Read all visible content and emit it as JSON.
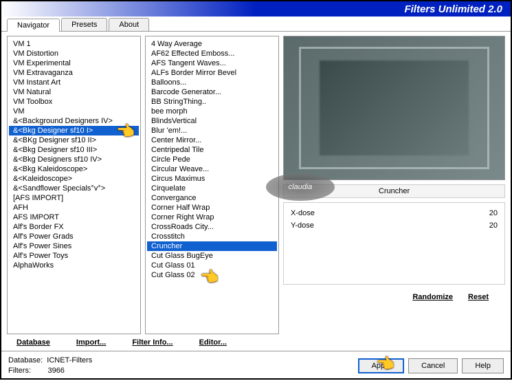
{
  "title": "Filters Unlimited 2.0",
  "tabs": [
    "Navigator",
    "Presets",
    "About"
  ],
  "list1": [
    "VM 1",
    "VM Distortion",
    "VM Experimental",
    "VM Extravaganza",
    "VM Instant Art",
    "VM Natural",
    "VM Toolbox",
    "VM",
    "&<Background Designers IV>",
    "&<Bkg Designer sf10 I>",
    "&<BKg Designer sf10 II>",
    "&<Bkg Designer sf10 III>",
    "&<Bkg Designers sf10 IV>",
    "&<Bkg Kaleidoscope>",
    "&<Kaleidoscope>",
    "&<Sandflower Specials°v°>",
    "[AFS IMPORT]",
    "AFH",
    "AFS IMPORT",
    "Alf's Border FX",
    "Alf's Power Grads",
    "Alf's Power Sines",
    "Alf's Power Toys",
    "AlphaWorks"
  ],
  "list1_selected": 9,
  "list2": [
    "4 Way Average",
    "AF62 Effected Emboss...",
    "AFS Tangent Waves...",
    "ALFs Border Mirror Bevel",
    "Balloons...",
    "Barcode Generator...",
    "BB StringThing..",
    "bee morph",
    "BlindsVertical",
    "Blur 'em!...",
    "Center Mirror...",
    "Centripedal Tile",
    "Circle Pede",
    "Circular Weave...",
    "Circus Maximus",
    "Cirquelate",
    "Convergance",
    "Corner Half Wrap",
    "Corner Right Wrap",
    "CrossRoads City...",
    "Crosstitch",
    "Cruncher",
    "Cut Glass  BugEye",
    "Cut Glass 01",
    "Cut Glass 02"
  ],
  "list2_selected": 21,
  "filter_name": "Cruncher",
  "params": [
    {
      "label": "X-dose",
      "value": "20"
    },
    {
      "label": "Y-dose",
      "value": "20"
    }
  ],
  "link_buttons": [
    "Database",
    "Import...",
    "Filter Info...",
    "Editor..."
  ],
  "right_links": [
    "Randomize",
    "Reset"
  ],
  "footer": {
    "db_label": "Database:",
    "db_value": "ICNET-Filters",
    "filters_label": "Filters:",
    "filters_value": "3966"
  },
  "footer_buttons": [
    "Apply",
    "Cancel",
    "Help"
  ],
  "watermark": "claudia"
}
